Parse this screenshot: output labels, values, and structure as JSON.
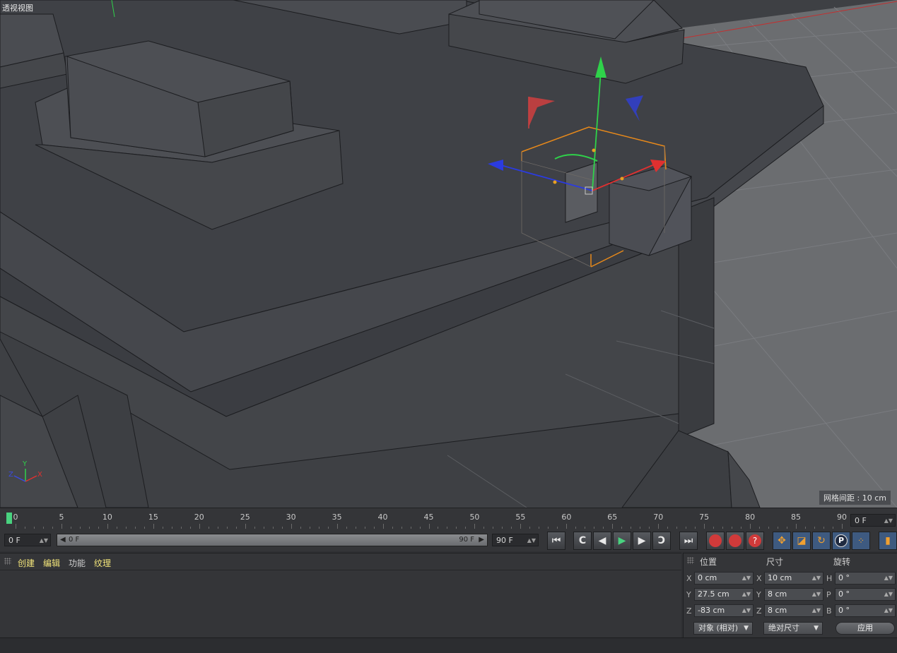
{
  "viewport": {
    "title": "透视视图",
    "grid_info": "网格间距 : 10 cm",
    "axis_labels": {
      "x": "X",
      "y": "Y",
      "z": "Z"
    }
  },
  "timeline": {
    "ticks": [
      "0",
      "5",
      "10",
      "15",
      "20",
      "25",
      "30",
      "35",
      "40",
      "45",
      "50",
      "55",
      "60",
      "65",
      "70",
      "75",
      "80",
      "85",
      "90"
    ],
    "current_frame": "0 F"
  },
  "transport": {
    "start_frame": "0 F",
    "range_start": "0 F",
    "range_end": "90 F",
    "end_frame": "90 F",
    "buttons": [
      "go-to-start",
      "prev-key",
      "prev-frame",
      "play",
      "next-frame",
      "next-key",
      "go-to-end",
      "record",
      "autokey",
      "keyframe-help",
      "move-key",
      "scale-key",
      "rotate-key",
      "param-key",
      "point-level",
      "timeline-view"
    ]
  },
  "menu": {
    "items": [
      "创建",
      "编辑",
      "功能",
      "纹理"
    ]
  },
  "coords": {
    "headers": {
      "position": "位置",
      "size": "尺寸",
      "rotation": "旋转"
    },
    "position": [
      {
        "axis": "X",
        "value": "0 cm"
      },
      {
        "axis": "Y",
        "value": "27.5 cm"
      },
      {
        "axis": "Z",
        "value": "-83 cm"
      }
    ],
    "size": [
      {
        "axis": "X",
        "value": "10 cm"
      },
      {
        "axis": "Y",
        "value": "8 cm"
      },
      {
        "axis": "Z",
        "value": "8 cm"
      }
    ],
    "rotation": [
      {
        "axis": "H",
        "value": "0 °"
      },
      {
        "axis": "P",
        "value": "0 °"
      },
      {
        "axis": "B",
        "value": "0 °"
      }
    ],
    "mode_dropdown": "对象 (相对)",
    "size_dropdown": "绝对尺寸",
    "apply_label": "应用"
  },
  "colors": {
    "accent_green": "#49d27f",
    "menu_yellow": "#f3e57a",
    "gizmo_x": "#e03030",
    "gizmo_y": "#2fd24a",
    "gizmo_z": "#2b3be0",
    "selection_orange": "#e8891a"
  }
}
